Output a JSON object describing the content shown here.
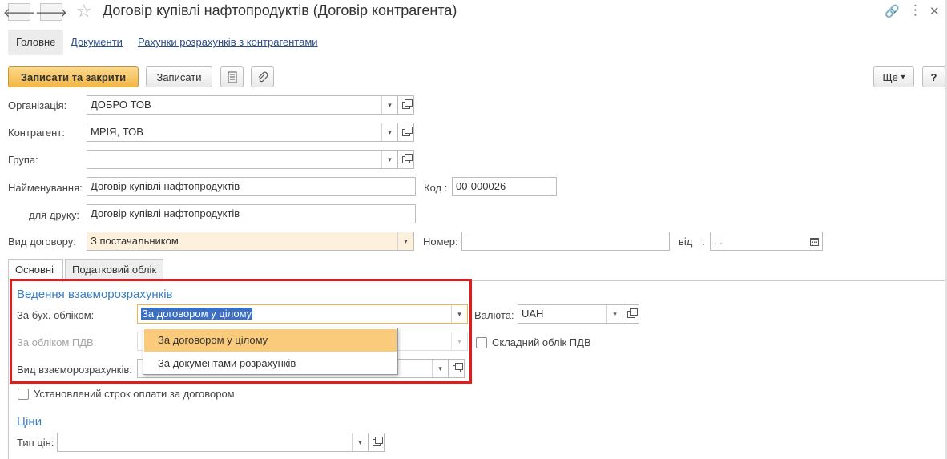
{
  "window": {
    "title": "Договір купівлі нафтопродуктів (Договір контрагента)",
    "back_glyph": "🡐",
    "forward_glyph": "🡒",
    "star_glyph": "☆",
    "link_glyph": "🔗",
    "menu_glyph": "⋮",
    "close_glyph": "✕"
  },
  "sections": {
    "main": "Головне",
    "documents": "Документи",
    "accounts": "Рахунки розрахунків з контрагентами"
  },
  "toolbar": {
    "save_close": "Записати та закрити",
    "save": "Записати",
    "more": "Ще",
    "more_arrow": "▾",
    "help": "?"
  },
  "form": {
    "org_label": "Організація:",
    "org_value": "ДОБРО ТОВ",
    "counterparty_label": "Контрагент:",
    "counterparty_value": "МРІЯ, ТОВ",
    "group_label": "Група:",
    "group_value": "",
    "name_label": "Найменування:",
    "name_value": "Договір купівлі нафтопродуктів",
    "code_label": "Код :",
    "code_value": "00-000026",
    "print_label": "для друку:",
    "print_value": "Договір купівлі нафтопродуктів",
    "contract_type_label": "Вид договору:",
    "contract_type_value": "З постачальником",
    "number_label": "Номер:",
    "number_value": "",
    "date_label": "від",
    "date_colon": ":",
    "date_value": " .  .",
    "dd_glyph": "▾"
  },
  "tabs": {
    "main": "Основні",
    "tax": "Податковий облік"
  },
  "settlements": {
    "title": "Ведення взаєморозрахунків",
    "accounting_label": "За бух. обліком:",
    "accounting_value": "За договором у цілому",
    "vat_label": "За обліком ПДВ:",
    "vat_value": "",
    "kind_label": "Вид взаєморозрахунків:",
    "kind_value": "",
    "currency_label": "Валюта:",
    "currency_value": "UAH",
    "complex_vat_label": "Складний облік ПДВ",
    "payment_term_label": "Установлений строк оплати за договором"
  },
  "dropdown": {
    "options": [
      "За договором у цілому",
      "За документами розрахунків"
    ]
  },
  "prices": {
    "title": "Ціни",
    "price_type_label": "Тип цін:",
    "price_type_value": ""
  }
}
